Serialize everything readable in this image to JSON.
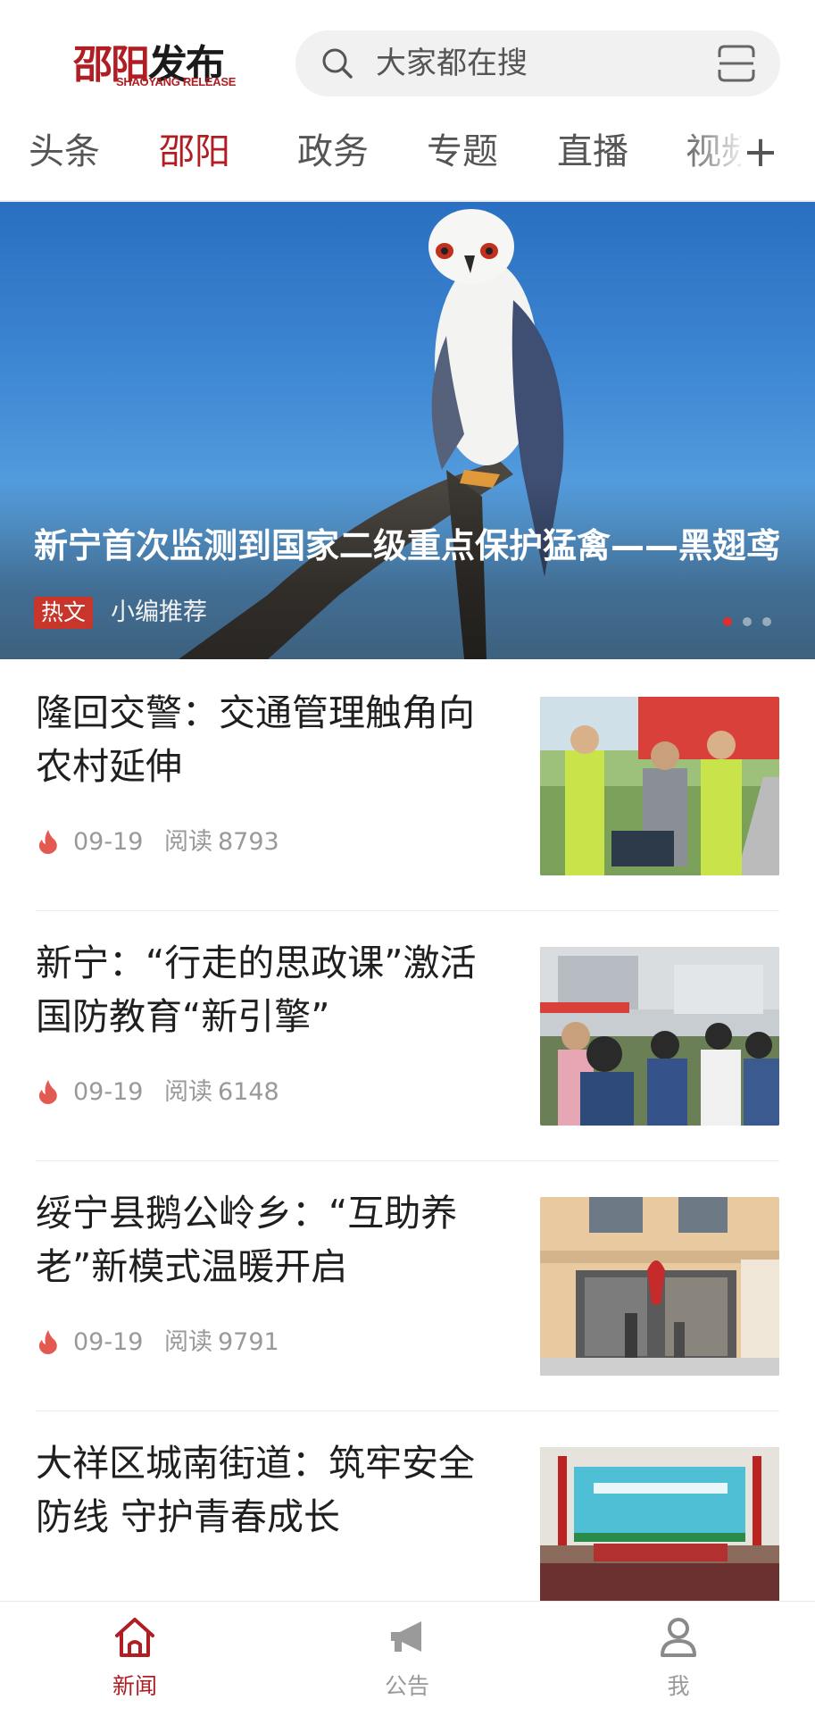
{
  "header": {
    "logo_cn_part1": "邵阳",
    "logo_cn_part2": "发布",
    "logo_en": "SHAOYANG RELEASE",
    "search_placeholder": "大家都在搜",
    "icons": [
      "search-icon",
      "scan-icon"
    ]
  },
  "tabs": [
    {
      "label": "头条",
      "active": false
    },
    {
      "label": "邵阳",
      "active": true
    },
    {
      "label": "政务",
      "active": false
    },
    {
      "label": "专题",
      "active": false
    },
    {
      "label": "直播",
      "active": false
    },
    {
      "label": "视频",
      "active": false
    }
  ],
  "tabs_more": "+",
  "banner": {
    "title": "新宁首次监测到国家二级重点保护猛禽——黑翅鸢",
    "badge": "热文",
    "subtitle": "小编推荐",
    "slide_count": 3,
    "active_slide": 1
  },
  "news": [
    {
      "title": "隆回交警：交通管理触角向农村延伸",
      "date": "09-19",
      "read_label": "阅读",
      "read_count": "8793"
    },
    {
      "title": "新宁：“行走的思政课”激活国防教育“新引擎”",
      "date": "09-19",
      "read_label": "阅读",
      "read_count": "6148"
    },
    {
      "title": "绥宁县鹅公岭乡：“互助养老”新模式温暖开启",
      "date": "09-19",
      "read_label": "阅读",
      "read_count": "9791"
    },
    {
      "title": "大祥区城南街道：筑牢安全防线 守护青春成长",
      "date": "",
      "read_label": "",
      "read_count": ""
    }
  ],
  "bottom_nav": [
    {
      "label": "新闻",
      "icon": "home-icon",
      "active": true
    },
    {
      "label": "公告",
      "icon": "megaphone-icon",
      "active": false
    },
    {
      "label": "我",
      "icon": "person-icon",
      "active": false
    }
  ],
  "colors": {
    "brand_red": "#b01e23",
    "badge_red": "#c8352b",
    "muted": "#999999"
  }
}
